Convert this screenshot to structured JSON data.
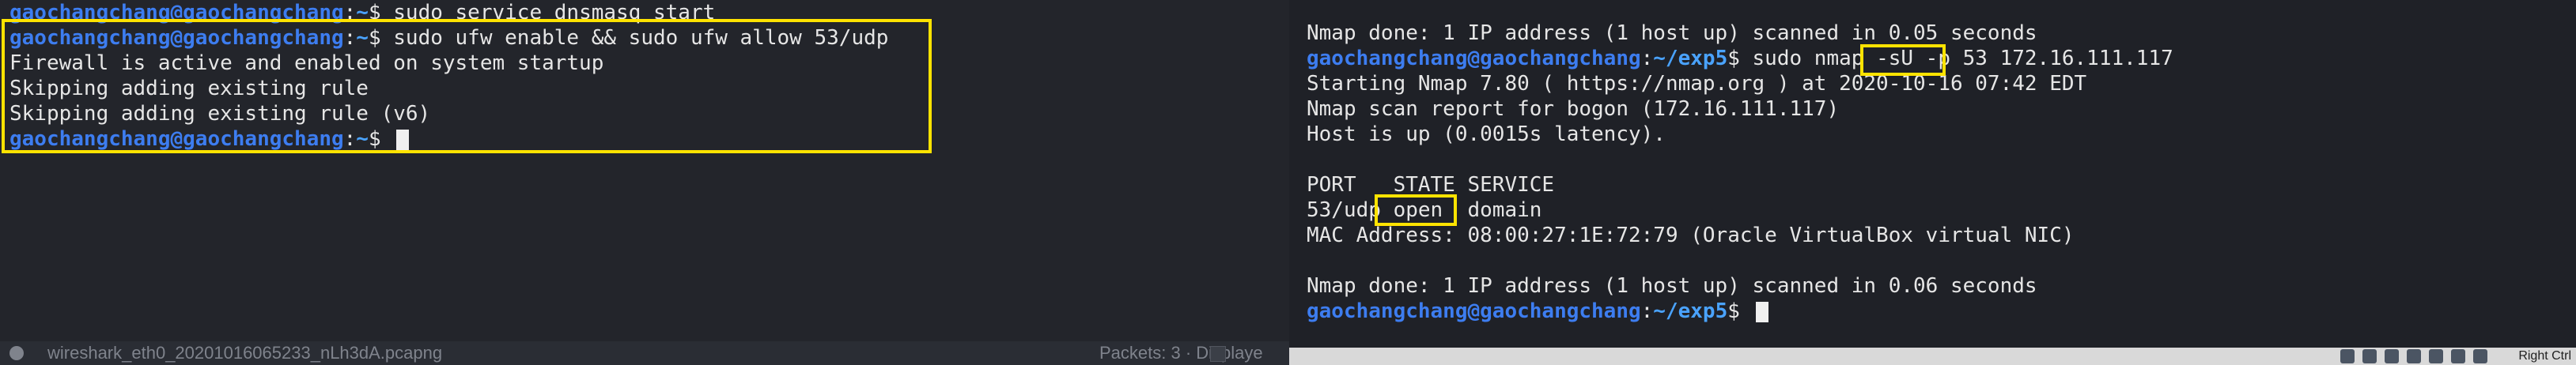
{
  "left_terminal": {
    "user": "gaochangchang@gaochangchang",
    "cwd": "~",
    "lines": [
      {
        "kind": "prompt",
        "command": "sudo service dnsmasq start"
      },
      {
        "kind": "prompt",
        "command": "sudo ufw enable && sudo ufw allow 53/udp"
      },
      {
        "kind": "output",
        "text": "Firewall is active and enabled on system startup"
      },
      {
        "kind": "output",
        "text": "Skipping adding existing rule"
      },
      {
        "kind": "output",
        "text": "Skipping adding existing rule (v6)"
      },
      {
        "kind": "prompt",
        "command": ""
      }
    ]
  },
  "right_terminal": {
    "user": "gaochangchang@gaochangchang",
    "cwd": "~/exp5",
    "lines": [
      {
        "kind": "output",
        "text": "Nmap done: 1 IP address (1 host up) scanned in 0.05 seconds"
      },
      {
        "kind": "prompt",
        "command": "sudo nmap -sU -p 53 172.16.111.117"
      },
      {
        "kind": "output",
        "text": "Starting Nmap 7.80 ( https://nmap.org ) at 2020-10-16 07:42 EDT"
      },
      {
        "kind": "output",
        "text": "Nmap scan report for bogon (172.16.111.117)"
      },
      {
        "kind": "output",
        "text": "Host is up (0.0015s latency)."
      },
      {
        "kind": "output",
        "text": ""
      },
      {
        "kind": "output",
        "text": "PORT   STATE SERVICE"
      },
      {
        "kind": "output",
        "text": "53/udp open  domain"
      },
      {
        "kind": "output",
        "text": "MAC Address: 08:00:27:1E:72:79 (Oracle VirtualBox virtual NIC)"
      },
      {
        "kind": "output",
        "text": ""
      },
      {
        "kind": "output",
        "text": "Nmap done: 1 IP address (1 host up) scanned in 0.06 seconds"
      },
      {
        "kind": "prompt",
        "command": ""
      }
    ]
  },
  "bottom_bar": {
    "filename": "wireshark_eth0_20201016065233_nLh3dA.pcapng",
    "packets": "Packets: 3 · Displaye"
  },
  "tray": {
    "text": "Right Ctrl"
  },
  "colors": {
    "highlight": "#ffe300",
    "user": "#3d7df0",
    "path": "#4aa3ff"
  }
}
